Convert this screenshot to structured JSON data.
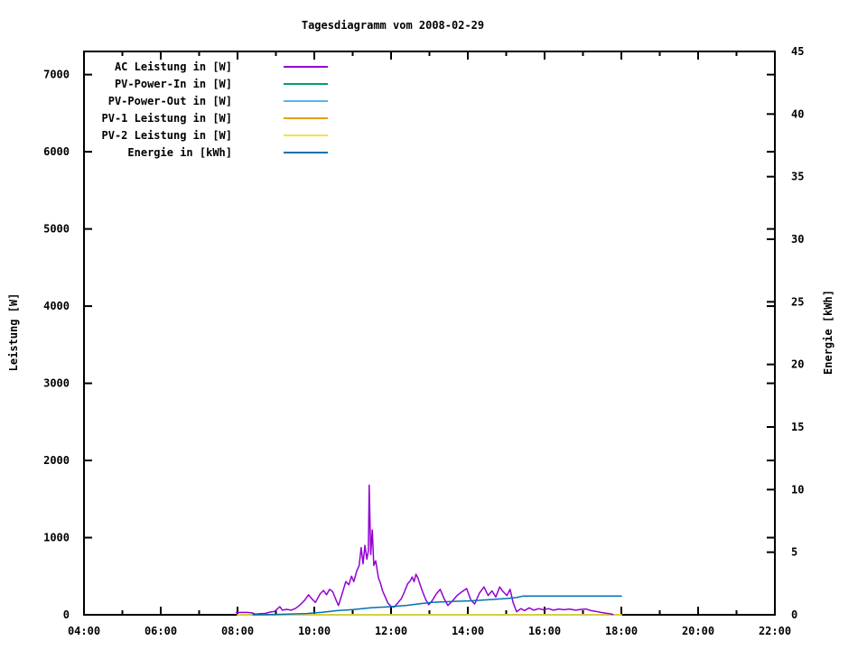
{
  "chart_data": {
    "type": "line",
    "title": "Tagesdiagramm vom 2008-02-29",
    "ylabel": "Leistung [W]",
    "y2label": "Energie [kWh]",
    "xlim_hours": [
      4,
      22
    ],
    "ylim": [
      0,
      7300
    ],
    "y2lim": [
      0,
      45
    ],
    "grid": false,
    "legend_position": "top-left-inside",
    "x_ticks": [
      {
        "h": 4,
        "label": "04:00"
      },
      {
        "h": 6,
        "label": "06:00"
      },
      {
        "h": 8,
        "label": "08:00"
      },
      {
        "h": 10,
        "label": "10:00"
      },
      {
        "h": 12,
        "label": "12:00"
      },
      {
        "h": 14,
        "label": "14:00"
      },
      {
        "h": 16,
        "label": "16:00"
      },
      {
        "h": 18,
        "label": "18:00"
      },
      {
        "h": 20,
        "label": "20:00"
      },
      {
        "h": 22,
        "label": "22:00"
      }
    ],
    "x_minor_ticks": [
      5,
      7,
      9,
      11,
      13,
      15,
      17,
      19,
      21
    ],
    "y_ticks": [
      {
        "v": 0,
        "label": "0"
      },
      {
        "v": 1000,
        "label": "1000"
      },
      {
        "v": 2000,
        "label": "2000"
      },
      {
        "v": 3000,
        "label": "3000"
      },
      {
        "v": 4000,
        "label": "4000"
      },
      {
        "v": 5000,
        "label": "5000"
      },
      {
        "v": 6000,
        "label": "6000"
      },
      {
        "v": 7000,
        "label": "7000"
      }
    ],
    "y2_ticks": [
      {
        "v": 0,
        "label": "0"
      },
      {
        "v": 5,
        "label": "5"
      },
      {
        "v": 10,
        "label": "10"
      },
      {
        "v": 15,
        "label": "15"
      },
      {
        "v": 20,
        "label": "20"
      },
      {
        "v": 25,
        "label": "25"
      },
      {
        "v": 30,
        "label": "30"
      },
      {
        "v": 35,
        "label": "35"
      },
      {
        "v": 40,
        "label": "40"
      },
      {
        "v": 45,
        "label": "45"
      }
    ],
    "series": [
      {
        "name": "AC Leistung in [W]",
        "color": "#9400d3",
        "axis": "y1",
        "points": [
          [
            7.97,
            30
          ],
          [
            8.1,
            30
          ],
          [
            8.25,
            30
          ],
          [
            8.38,
            25
          ],
          [
            8.47,
            8
          ],
          [
            8.6,
            15
          ],
          [
            8.72,
            18
          ],
          [
            8.85,
            35
          ],
          [
            8.97,
            45
          ],
          [
            9.1,
            105
          ],
          [
            9.17,
            60
          ],
          [
            9.28,
            70
          ],
          [
            9.4,
            60
          ],
          [
            9.52,
            85
          ],
          [
            9.63,
            130
          ],
          [
            9.75,
            190
          ],
          [
            9.85,
            260
          ],
          [
            9.93,
            210
          ],
          [
            10.03,
            160
          ],
          [
            10.15,
            270
          ],
          [
            10.24,
            315
          ],
          [
            10.32,
            260
          ],
          [
            10.4,
            330
          ],
          [
            10.48,
            300
          ],
          [
            10.56,
            200
          ],
          [
            10.63,
            120
          ],
          [
            10.73,
            280
          ],
          [
            10.82,
            430
          ],
          [
            10.9,
            390
          ],
          [
            10.97,
            500
          ],
          [
            11.03,
            430
          ],
          [
            11.1,
            560
          ],
          [
            11.17,
            640
          ],
          [
            11.22,
            870
          ],
          [
            11.27,
            660
          ],
          [
            11.32,
            900
          ],
          [
            11.37,
            720
          ],
          [
            11.41,
            830
          ],
          [
            11.43,
            1680
          ],
          [
            11.47,
            780
          ],
          [
            11.51,
            1100
          ],
          [
            11.55,
            640
          ],
          [
            11.6,
            700
          ],
          [
            11.67,
            480
          ],
          [
            11.73,
            400
          ],
          [
            11.78,
            310
          ],
          [
            11.85,
            230
          ],
          [
            11.92,
            150
          ],
          [
            12.0,
            110
          ],
          [
            12.08,
            100
          ],
          [
            12.17,
            150
          ],
          [
            12.27,
            210
          ],
          [
            12.35,
            300
          ],
          [
            12.43,
            400
          ],
          [
            12.5,
            440
          ],
          [
            12.55,
            490
          ],
          [
            12.6,
            430
          ],
          [
            12.65,
            525
          ],
          [
            12.7,
            480
          ],
          [
            12.75,
            400
          ],
          [
            12.82,
            300
          ],
          [
            12.9,
            200
          ],
          [
            12.98,
            130
          ],
          [
            13.08,
            190
          ],
          [
            13.18,
            270
          ],
          [
            13.28,
            330
          ],
          [
            13.38,
            210
          ],
          [
            13.48,
            120
          ],
          [
            13.6,
            180
          ],
          [
            13.72,
            250
          ],
          [
            13.85,
            300
          ],
          [
            13.97,
            340
          ],
          [
            14.08,
            190
          ],
          [
            14.18,
            140
          ],
          [
            14.3,
            280
          ],
          [
            14.42,
            360
          ],
          [
            14.53,
            250
          ],
          [
            14.63,
            310
          ],
          [
            14.73,
            230
          ],
          [
            14.83,
            360
          ],
          [
            14.92,
            300
          ],
          [
            15.02,
            250
          ],
          [
            15.1,
            330
          ],
          [
            15.18,
            160
          ],
          [
            15.27,
            40
          ],
          [
            15.38,
            80
          ],
          [
            15.48,
            55
          ],
          [
            15.6,
            90
          ],
          [
            15.72,
            60
          ],
          [
            15.85,
            80
          ],
          [
            15.97,
            65
          ],
          [
            16.1,
            80
          ],
          [
            16.23,
            60
          ],
          [
            16.37,
            75
          ],
          [
            16.5,
            65
          ],
          [
            16.65,
            75
          ],
          [
            16.8,
            60
          ],
          [
            16.95,
            70
          ],
          [
            17.08,
            75
          ],
          [
            17.2,
            55
          ],
          [
            17.33,
            45
          ],
          [
            17.47,
            30
          ],
          [
            17.6,
            20
          ],
          [
            17.72,
            12
          ],
          [
            17.78,
            5
          ]
        ]
      },
      {
        "name": "PV-Power-In in [W]",
        "color": "#009e73",
        "axis": "y1",
        "points": [
          [
            8.0,
            0
          ],
          [
            18.0,
            0
          ]
        ]
      },
      {
        "name": "PV-Power-Out in [W]",
        "color": "#56b4e9",
        "axis": "y1",
        "points": [
          [
            8.0,
            0
          ],
          [
            18.0,
            0
          ]
        ]
      },
      {
        "name": "PV-1 Leistung in [W]",
        "color": "#e69f00",
        "axis": "y1",
        "points": [
          [
            8.0,
            0
          ],
          [
            18.0,
            0
          ]
        ]
      },
      {
        "name": "PV-2 Leistung in [W]",
        "color": "#f0e442",
        "axis": "y1",
        "points": [
          [
            8.0,
            0
          ],
          [
            18.0,
            0
          ]
        ]
      },
      {
        "name": "Energie in [kWh]",
        "color": "#0072b2",
        "axis": "y2",
        "points": [
          [
            8.4,
            0
          ],
          [
            9.0,
            0.03
          ],
          [
            9.3,
            0.05
          ],
          [
            9.8,
            0.1
          ],
          [
            10.2,
            0.2
          ],
          [
            10.6,
            0.33
          ],
          [
            11.0,
            0.42
          ],
          [
            11.5,
            0.57
          ],
          [
            12.0,
            0.65
          ],
          [
            12.4,
            0.75
          ],
          [
            12.8,
            0.9
          ],
          [
            13.1,
            1.0
          ],
          [
            13.6,
            1.07
          ],
          [
            14.1,
            1.12
          ],
          [
            14.6,
            1.22
          ],
          [
            15.0,
            1.3
          ],
          [
            15.25,
            1.37
          ],
          [
            15.45,
            1.5
          ],
          [
            16.5,
            1.5
          ],
          [
            18.0,
            1.5
          ]
        ]
      }
    ],
    "draw_order": [
      1,
      2,
      3,
      4,
      0,
      5
    ]
  }
}
